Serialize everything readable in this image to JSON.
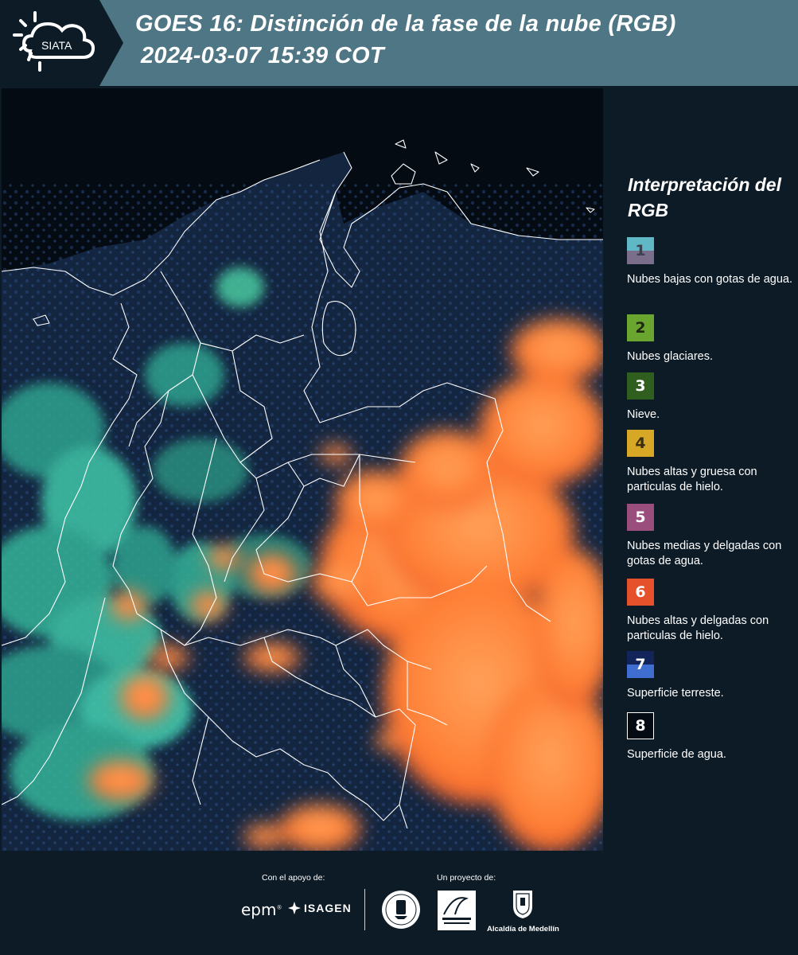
{
  "header": {
    "logo_text": "SIATA",
    "title_line1": "GOES 16: Distinción de la fase de la nube (RGB)",
    "title_line2": "2024-03-07 15:39 COT"
  },
  "map": {
    "icon": "satellite-composite-map",
    "colors": {
      "background": "#050b12",
      "land": "#13253f",
      "cloud_high": "#ff8a3d",
      "cloud_low": "#3fc6a8",
      "boundaries": "#ffffff"
    }
  },
  "legend": {
    "title": "Interpretación del RGB",
    "items": [
      {
        "number": "1",
        "label": "Nubes bajas con gotas de agua.",
        "color_top": "#5fb8c4",
        "color_bottom": "#7a6e8a",
        "number_color": "#3b4150"
      },
      {
        "number": "2",
        "label": "Nubes glaciares.",
        "color": "#6aa52f",
        "number_color": "#1f2a12"
      },
      {
        "number": "3",
        "label": "Nieve.",
        "color": "#2f5e1e",
        "number_color": "#ffffff"
      },
      {
        "number": "4",
        "label": "Nubes altas y gruesa con particulas de hielo.",
        "color": "#d7a826",
        "number_color": "#3b2f10"
      },
      {
        "number": "5",
        "label": "Nubes medias y delgadas con gotas de agua.",
        "color": "#9a4e7d",
        "number_color": "#ffffff"
      },
      {
        "number": "6",
        "label": "Nubes altas y delgadas con particulas de hielo.",
        "color": "#e5512a",
        "number_color": "#ffffff"
      },
      {
        "number": "7",
        "label": "Superficie terreste.",
        "color_top": "#12245a",
        "color_bottom": "#3f6ed0",
        "number_color": "#ffffff"
      },
      {
        "number": "8",
        "label": "Superficie de agua.",
        "color": "#050b12",
        "number_color": "#ffffff"
      }
    ]
  },
  "footer": {
    "support_label": "Con el apoyo de:",
    "project_label": "Un proyecto de:",
    "epm": "epm",
    "isagen": "ISAGEN",
    "alcaldia": "Alcaldía de Medellín"
  }
}
